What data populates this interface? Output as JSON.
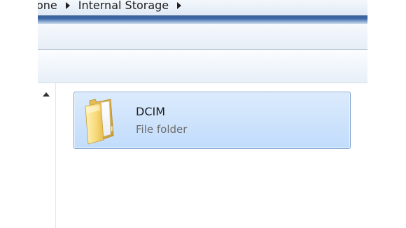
{
  "breadcrumb": {
    "items": [
      "one",
      "Internal Storage"
    ]
  },
  "content": {
    "items": [
      {
        "name": "DCIM",
        "type": "File folder",
        "icon": "folder-icon",
        "selected": true
      }
    ]
  },
  "colors": {
    "selection_fill": "#c8e0fc",
    "selection_border": "#7da2ce",
    "title_band": "#3c6aa8",
    "secondary_text": "#6d6d6d"
  }
}
